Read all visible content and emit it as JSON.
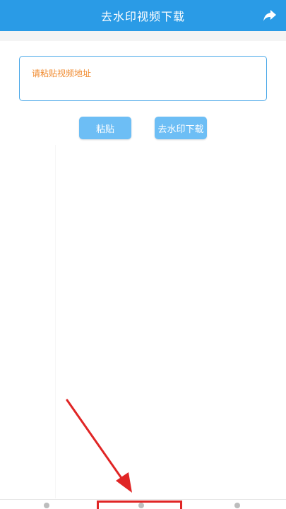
{
  "header": {
    "title": "去水印视频下载",
    "share_icon": "share-arrow-icon"
  },
  "url_box": {
    "placeholder": "请粘贴视频地址"
  },
  "buttons": {
    "paste_label": "粘贴",
    "download_label": "去水印下载"
  },
  "colors": {
    "header_bg": "#2a9be6",
    "button_bg": "#6dbef5",
    "placeholder_text": "#f08a2e",
    "annotation": "#e02525"
  },
  "annotation": {
    "type": "red-arrow-pointing-to-bottom-nav-center",
    "icon": "red-arrow-icon"
  },
  "bottom_nav": {
    "items": [
      "nav-item-1",
      "nav-item-2",
      "nav-item-3"
    ],
    "highlighted_index": 1
  }
}
